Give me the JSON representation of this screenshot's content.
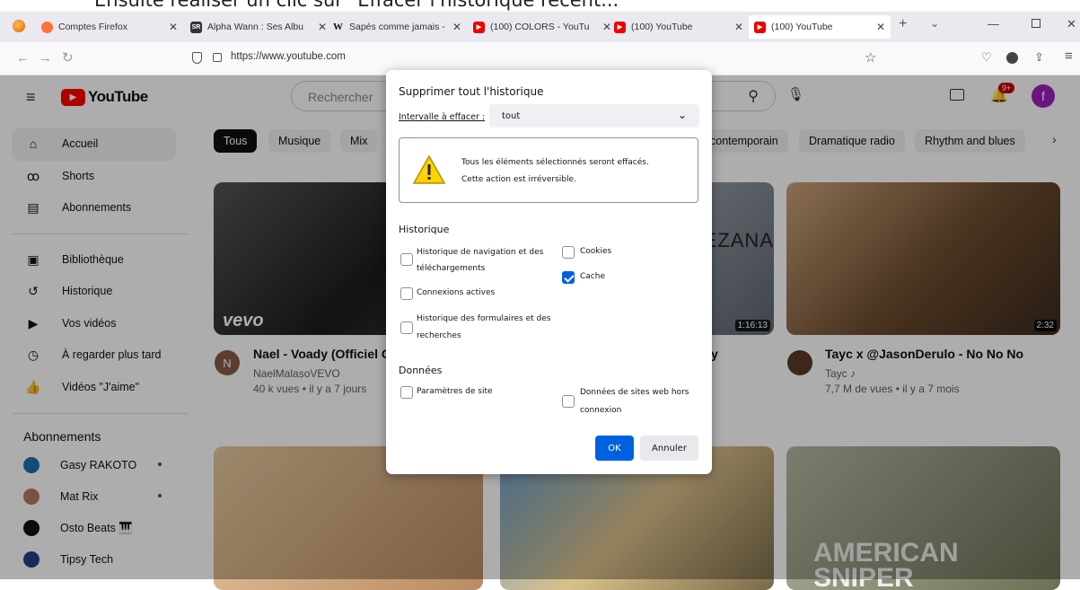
{
  "caption": "Ensuite réaliser un clic sur \"Effacer l'historique récent...\"",
  "browser": {
    "tabs": [
      {
        "label": "Comptes Firefox",
        "icon": "firefox-account-icon"
      },
      {
        "label": "Alpha Wann : Ses Albu",
        "icon": "genius-icon"
      },
      {
        "label": "Sapés comme jamais -",
        "icon": "wikipedia-icon"
      },
      {
        "label": "(100) COLORS - YouTu",
        "icon": "youtube-icon"
      },
      {
        "label": "(100) YouTube",
        "icon": "youtube-icon"
      },
      {
        "label": "(100) YouTube",
        "icon": "youtube-icon"
      }
    ],
    "url": "https://www.youtube.com"
  },
  "youtube": {
    "logo": "YouTube",
    "search_placeholder": "Rechercher",
    "notif_badge": "9+",
    "avatar": "f",
    "sidebar": [
      {
        "label": "Accueil",
        "icon": "home-icon"
      },
      {
        "label": "Shorts",
        "icon": "shorts-icon"
      },
      {
        "label": "Abonnements",
        "icon": "subscriptions-icon"
      },
      {
        "label": "Bibliothèque",
        "icon": "library-icon"
      },
      {
        "label": "Historique",
        "icon": "history-icon"
      },
      {
        "label": "Vos vidéos",
        "icon": "your-videos-icon"
      },
      {
        "label": "À regarder plus tard",
        "icon": "watch-later-icon"
      },
      {
        "label": "Vidéos \"J'aime\"",
        "icon": "liked-icon"
      }
    ],
    "subs_title": "Abonnements",
    "subs": [
      {
        "label": "Gasy RAKOTO"
      },
      {
        "label": "Mat Rix"
      },
      {
        "label": "Osto Beats 🎹"
      },
      {
        "label": "Tipsy Tech"
      }
    ],
    "chips": [
      "Tous",
      "Musique",
      "Mix",
      "contemporain",
      "Dramatique radio",
      "Rhythm and blues"
    ],
    "videos": [
      {
        "title": "Nael - Voady (Officiel Cl",
        "channel": "NaelMalasoVEVO",
        "meta": "40 k vues • il y a 7 jours",
        "badge": "vevo"
      },
      {
        "title": "y",
        "duration": "1:16:13",
        "overlay": "EZANA"
      },
      {
        "title": "Tayc x @JasonDerulo - No No No",
        "channel": "Tayc ♪",
        "meta": "7,7 M de vues • il y a 7 mois",
        "duration": "2:32"
      }
    ],
    "bottom_overlay": "AMERICAN SNIPER"
  },
  "dialog": {
    "title": "Supprimer tout l'historique",
    "range_label": "Intervalle à effacer :",
    "range_value": "tout",
    "warning_line1": "Tous les éléments sélectionnés seront effacés.",
    "warning_line2": "Cette action est irréversible.",
    "history_heading": "Historique",
    "opt_nav_1": "Historique de navigation et des",
    "opt_nav_2": "téléchargements",
    "opt_cookies": "Cookies",
    "opt_cache": "Cache",
    "opt_connexions": "Connexions actives",
    "opt_forms_1": "Historique des formulaires et des",
    "opt_forms_2": "recherches",
    "data_heading": "Données",
    "opt_site_params": "Paramètres de site",
    "opt_offline_1": "Données de sites web hors",
    "opt_offline_2": "connexion",
    "ok": "OK",
    "cancel": "Annuler",
    "checked": {
      "nav": false,
      "cookies": false,
      "cache": true,
      "connexions": false,
      "forms": false,
      "site_params": false,
      "offline": false
    }
  },
  "colors": {
    "accent": "#0061e0",
    "youtube_red": "#ff0000"
  }
}
